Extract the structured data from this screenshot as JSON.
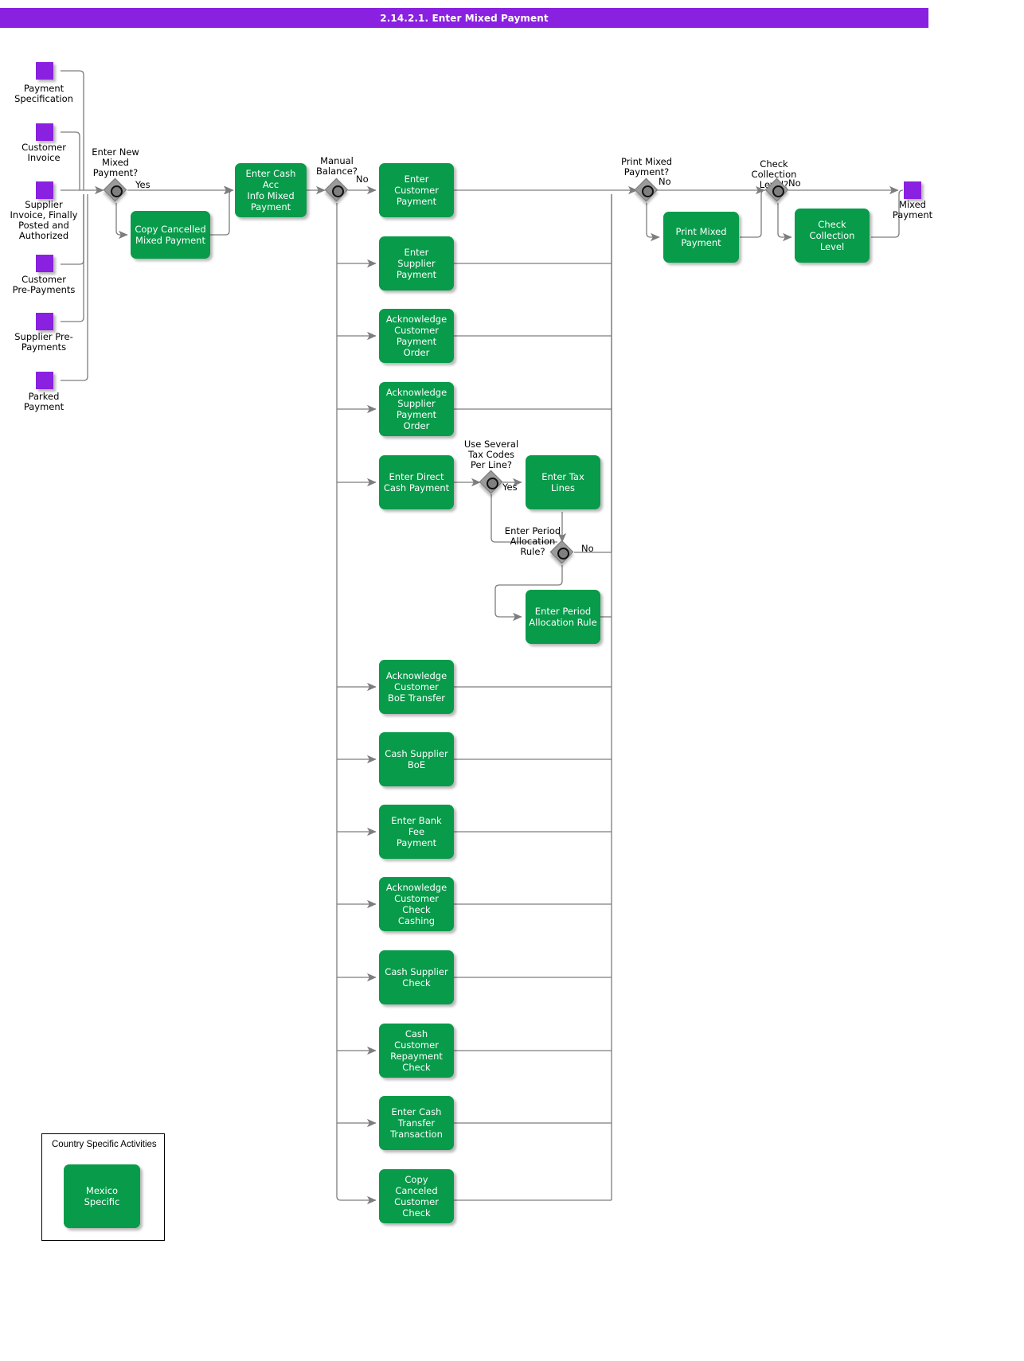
{
  "header": {
    "title": "2.14.2.1. Enter Mixed Payment",
    "bar_color": "#8A20E0",
    "text_color": "#FFFFFF"
  },
  "palette": {
    "activity_green": "#079B4A",
    "event_purple": "#8A20E0",
    "gateway_gray": "#9A9A9A",
    "connector_gray": "#808080",
    "background": "#FFFFFF"
  },
  "diagram": {
    "type": "bpmn-flowchart",
    "inputs": [
      {
        "id": "in1",
        "label": "Payment\nSpecification",
        "label_line1": "Payment",
        "label_line2": "Specification"
      },
      {
        "id": "in2",
        "label": "Customer\nInvoice",
        "label_line1": "Customer",
        "label_line2": "Invoice"
      },
      {
        "id": "in3",
        "label": "Supplier Invoice, Finally Posted and Authorized",
        "label_line1": "Supplier",
        "label_line2": "Invoice, Finally",
        "label_line3": "Posted and",
        "label_line4": "Authorized"
      },
      {
        "id": "in4",
        "label": "Customer\nPre-Payments",
        "label_line1": "Customer",
        "label_line2": "Pre-Payments"
      },
      {
        "id": "in5",
        "label": "Supplier Pre-Payments",
        "label_line1": "Supplier Pre-",
        "label_line2": "Payments"
      },
      {
        "id": "in6",
        "label": "Parked\nPayment",
        "label_line1": "Parked",
        "label_line2": "Payment"
      }
    ],
    "outputs": [
      {
        "id": "out1",
        "label": "Mixed Payment",
        "label_line1": "Mixed",
        "label_line2": "Payment"
      }
    ],
    "gateways": [
      {
        "id": "gw1",
        "label_line1": "Enter New",
        "label_line2": "Mixed",
        "label_line3": "Payment?",
        "yes_label": "Yes",
        "no_label": ""
      },
      {
        "id": "gw2",
        "label_line1": "Manual",
        "label_line2": "Balance?",
        "no_label": "No"
      },
      {
        "id": "gw3",
        "label_line1": "Use Several",
        "label_line2": "Tax Codes",
        "label_line3": "Per Line?",
        "yes_label": "Yes"
      },
      {
        "id": "gw4",
        "label_line1": "Enter Period",
        "label_line2": "Allocation",
        "label_line3": "Rule?",
        "no_label": "No"
      },
      {
        "id": "gw5",
        "label_line1": "Print Mixed",
        "label_line2": "Payment?",
        "no_label": "No"
      },
      {
        "id": "gw6",
        "label_line1": "Check",
        "label_line2": "Collection",
        "label_line3": "Level?",
        "no_label": "No"
      }
    ],
    "activities": [
      {
        "id": "a_copy_cancelled",
        "label_line1": "Copy Cancelled",
        "label_line2": "Mixed Payment"
      },
      {
        "id": "a_enter_cash_acc",
        "label_line1": "Enter Cash Acc",
        "label_line2": "Info Mixed",
        "label_line3": "Payment"
      },
      {
        "id": "a_enter_customer_payment",
        "label_line1": "Enter",
        "label_line2": "Customer",
        "label_line3": "Payment"
      },
      {
        "id": "a_enter_supplier_payment",
        "label_line1": "Enter",
        "label_line2": "Supplier",
        "label_line3": "Payment"
      },
      {
        "id": "a_ack_cust_payment_order",
        "label_line1": "Acknowledge",
        "label_line2": "Customer",
        "label_line3": "Payment Order"
      },
      {
        "id": "a_ack_supp_payment_order",
        "label_line1": "Acknowledge",
        "label_line2": "Supplier",
        "label_line3": "Payment",
        "label_line4": "Order"
      },
      {
        "id": "a_enter_direct_cash_payment",
        "label_line1": "Enter Direct",
        "label_line2": "Cash Payment"
      },
      {
        "id": "a_enter_tax_lines",
        "label_line1": "Enter Tax Lines"
      },
      {
        "id": "a_enter_period_alloc_rule",
        "label_line1": "Enter Period",
        "label_line2": "Allocation Rule"
      },
      {
        "id": "a_ack_cust_boe_transfer",
        "label_line1": "Acknowledge",
        "label_line2": "Customer",
        "label_line3": "BoE Transfer"
      },
      {
        "id": "a_cash_supplier_boe",
        "label_line1": "Cash Supplier",
        "label_line2": "BoE"
      },
      {
        "id": "a_enter_bank_fee_payment",
        "label_line1": "Enter Bank",
        "label_line2": "Fee",
        "label_line3": "Payment"
      },
      {
        "id": "a_ack_cust_check_cashing",
        "label_line1": "Acknowledge",
        "label_line2": "Customer Check",
        "label_line3": "Cashing"
      },
      {
        "id": "a_cash_supplier_check",
        "label_line1": "Cash Supplier",
        "label_line2": "Check"
      },
      {
        "id": "a_cash_cust_repayment_check",
        "label_line1": "Cash Customer",
        "label_line2": "Repayment",
        "label_line3": "Check"
      },
      {
        "id": "a_enter_cash_transfer_transaction",
        "label_line1": "Enter Cash",
        "label_line2": "Transfer",
        "label_line3": "Transaction"
      },
      {
        "id": "a_copy_canceled_cust_check",
        "label_line1": "Copy Canceled",
        "label_line2": "Customer Check"
      },
      {
        "id": "a_print_mixed_payment",
        "label_line1": "Print Mixed",
        "label_line2": "Payment"
      },
      {
        "id": "a_check_collection_level",
        "label_line1": "Check",
        "label_line2": "Collection",
        "label_line3": "Level"
      },
      {
        "id": "a_mexico_specific",
        "label_line1": "Mexico Specific"
      }
    ],
    "legend": {
      "title": "Country Specific Activities",
      "item_label": "Mexico Specific"
    }
  }
}
